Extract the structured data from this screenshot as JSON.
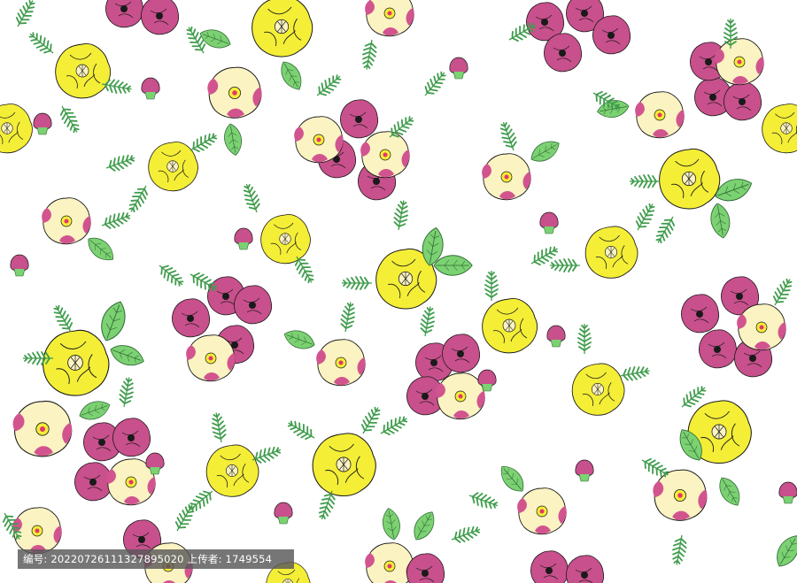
{
  "image": {
    "subject": "floral pattern",
    "colors": {
      "background": "#ffffff",
      "yellow_flower": "#f4ee37",
      "pale_flower": "#fbf3c2",
      "magenta_flower": "#c8508c",
      "leaf": "#7cd172",
      "leaf_dark": "#3f9c4c",
      "outline": "#1a1a1a",
      "center": "#e6346e"
    }
  },
  "caption": {
    "text": "编号: 20220726111327895020 上传者: 1749554"
  }
}
